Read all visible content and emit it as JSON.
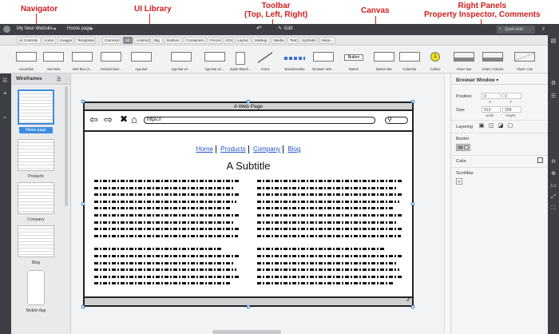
{
  "annotations": {
    "navigator": "Navigator",
    "ui_library": "UI Library",
    "toolbar": "Toolbar\n(Top, Left, Right)",
    "canvas": "Canvas",
    "right_panels": "Right Panels\nProperty Inspector, Comments"
  },
  "topbar": {
    "project": "My New Website",
    "page": "Home page",
    "edit": "Edit",
    "quick_add": "Quick Add"
  },
  "library_tabs": [
    "UI Controls",
    "Icons",
    "Images",
    "Templates",
    "Common",
    "All",
    "Android",
    "Big",
    "Buttons",
    "Containers",
    "Forms",
    "iOS",
    "Layout",
    "Markup",
    "Media",
    "Text",
    "Symbols",
    "More..."
  ],
  "library_selected": "All",
  "library_items": [
    "Accordion",
    "Alert Box",
    "Alert Box (A...",
    "Android Devi...",
    "App Bar",
    "App Bar w/ ...",
    "App Bar w/ ...",
    "Apple Watch...",
    "Arrow",
    "Breadcrumbs",
    "Browser Win...",
    "Button",
    "Button Bar",
    "Calendar",
    "Callout",
    "Chart: Bar",
    "Chart: Column",
    "Chart: Line"
  ],
  "library_button_text": "Button",
  "library_callout_text": "1",
  "navigator": {
    "title": "Wireframes",
    "pages": [
      {
        "label": "Home page",
        "selected": true
      },
      {
        "label": "Products",
        "selected": false
      },
      {
        "label": "Company",
        "selected": false
      },
      {
        "label": "Blog",
        "selected": false
      },
      {
        "label": "Mobile App",
        "selected": false
      }
    ]
  },
  "mockup": {
    "title": "A Web Page",
    "url": "https://",
    "links": [
      "Home",
      "Products",
      "Company",
      "Blog"
    ],
    "subtitle": "A Subtitle"
  },
  "inspector": {
    "title": "Browser Window",
    "position_label": "Position",
    "pos_x": "0",
    "pos_y": "0",
    "x_label": "X",
    "y_label": "Y",
    "size_label": "Size",
    "width": "413",
    "height": "258",
    "width_label": "width",
    "height_label": "height",
    "layering_label": "Layering",
    "border_label": "Border",
    "color_label": "Color",
    "scrollbar_label": "Scrollbar"
  },
  "zoom_labels": [
    "1:1"
  ],
  "colors": {
    "accent": "#3c8de0",
    "annotation": "#d11d1d",
    "chrome": "#3d3f44",
    "link": "#1f55c8"
  }
}
